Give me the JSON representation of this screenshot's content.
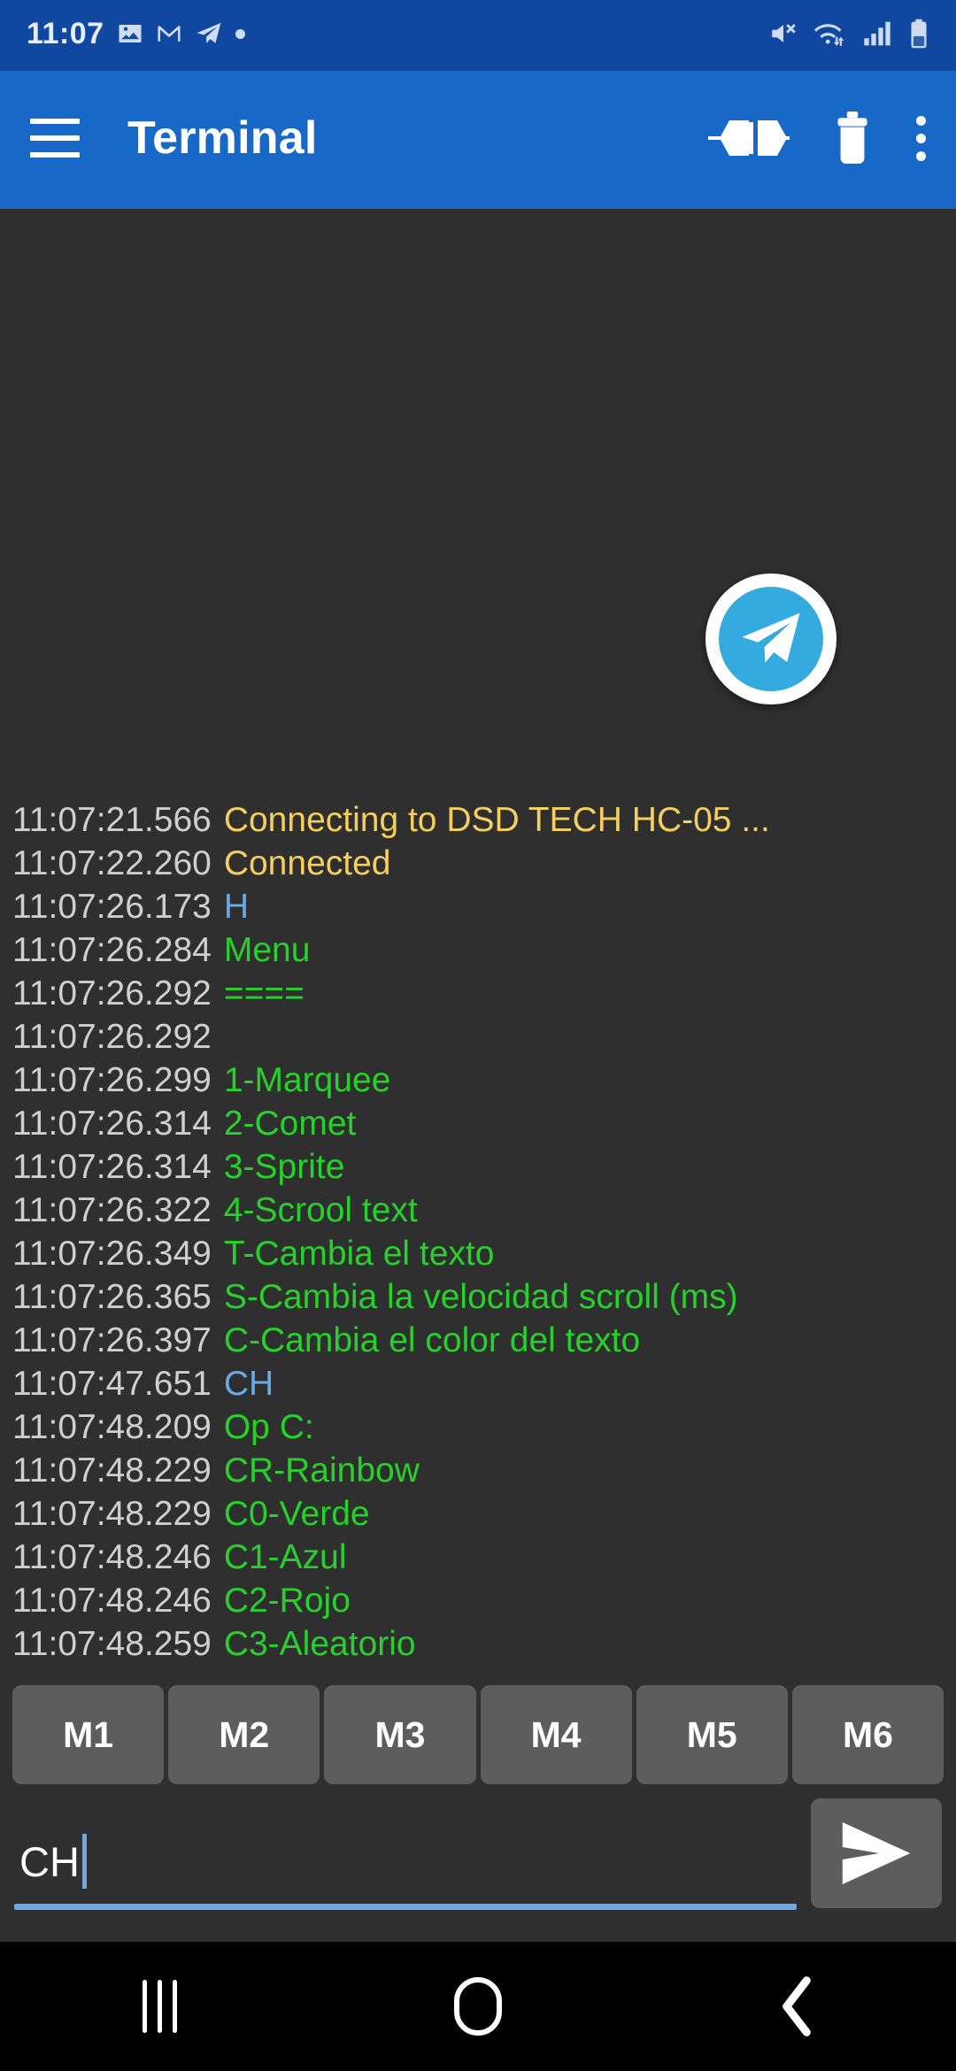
{
  "status_bar": {
    "time": "11:07",
    "left_icons": [
      "image-icon",
      "gmail-icon",
      "telegram-icon",
      "dot-icon"
    ],
    "right_icons": [
      "mute-icon",
      "wifi-icon",
      "signal-icon",
      "battery-icon"
    ],
    "background_color": "#0f47a1"
  },
  "app_bar": {
    "menu_icon": "hamburger-menu-icon",
    "title": "Terminal",
    "actions": [
      "connect-icon",
      "delete-icon",
      "overflow-menu-icon"
    ],
    "background_color": "#1868c8"
  },
  "floating_notification": {
    "icon": "telegram-icon",
    "badge_color": "#34aadf"
  },
  "terminal": {
    "background_color": "#2f2f2f",
    "colors": {
      "timestamp": "#cfcfcf",
      "status": "#f5cf5e",
      "sent": "#6aa9e8",
      "received": "#25d12a"
    },
    "lines": [
      {
        "ts": "11:07:21.566",
        "msg": "Connecting to DSD TECH HC-05 ...",
        "kind": "status"
      },
      {
        "ts": "11:07:22.260",
        "msg": "Connected",
        "kind": "status"
      },
      {
        "ts": "11:07:26.173",
        "msg": "H",
        "kind": "sent"
      },
      {
        "ts": "11:07:26.284",
        "msg": "Menu",
        "kind": "received"
      },
      {
        "ts": "11:07:26.292",
        "msg": "====",
        "kind": "received"
      },
      {
        "ts": "11:07:26.292",
        "msg": "",
        "kind": "received"
      },
      {
        "ts": "11:07:26.299",
        "msg": "1-Marquee",
        "kind": "received"
      },
      {
        "ts": "11:07:26.314",
        "msg": "2-Comet",
        "kind": "received"
      },
      {
        "ts": "11:07:26.314",
        "msg": "3-Sprite",
        "kind": "received"
      },
      {
        "ts": "11:07:26.322",
        "msg": "4-Scrool text",
        "kind": "received"
      },
      {
        "ts": "11:07:26.349",
        "msg": "T-Cambia el texto",
        "kind": "received"
      },
      {
        "ts": "11:07:26.365",
        "msg": "S-Cambia la velocidad scroll (ms)",
        "kind": "received"
      },
      {
        "ts": "11:07:26.397",
        "msg": "C-Cambia el color del texto",
        "kind": "received"
      },
      {
        "ts": "11:07:47.651",
        "msg": "CH",
        "kind": "sent"
      },
      {
        "ts": "11:07:48.209",
        "msg": "Op C:",
        "kind": "received"
      },
      {
        "ts": "11:07:48.229",
        "msg": "CR-Rainbow",
        "kind": "received"
      },
      {
        "ts": "11:07:48.229",
        "msg": "C0-Verde",
        "kind": "received"
      },
      {
        "ts": "11:07:48.246",
        "msg": "C1-Azul",
        "kind": "received"
      },
      {
        "ts": "11:07:48.246",
        "msg": "C2-Rojo",
        "kind": "received"
      },
      {
        "ts": "11:07:48.259",
        "msg": "C3-Aleatorio",
        "kind": "received"
      }
    ]
  },
  "macros": {
    "buttons": [
      "M1",
      "M2",
      "M3",
      "M4",
      "M5",
      "M6"
    ],
    "background_color": "#5d5d5d"
  },
  "input": {
    "value": "CH",
    "placeholder": "",
    "accent_color": "#6aa9e8",
    "send_icon": "send-icon"
  },
  "nav_bar": {
    "buttons": [
      "recents-icon",
      "home-icon",
      "back-icon"
    ],
    "background_color": "#000000"
  }
}
